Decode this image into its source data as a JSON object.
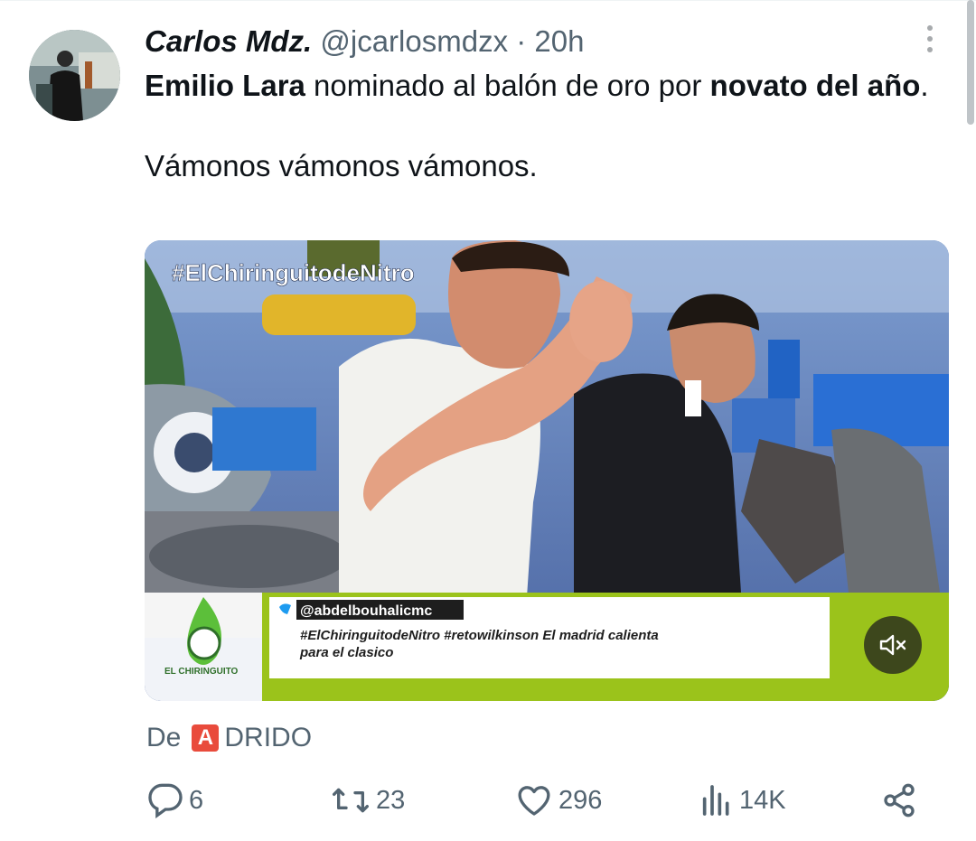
{
  "tweet": {
    "display_name": "Carlos Mdz.",
    "handle": "@jcarlosmdzx",
    "separator": "·",
    "time": "20h",
    "text_line1_bold_a": "Emilio Lara",
    "text_line1_plain": " nominado al balón de oro por ",
    "text_line1_bold_b": "novato del año",
    "text_line1_end": ".",
    "text_line2": "Vámonos vámonos vámonos.",
    "source_prefix": "De",
    "source_badge": "A",
    "source_name": "DRIDO"
  },
  "video": {
    "overlay_hashtag": "#ElChiringuitodeNitro",
    "ticker_user": "@abdelbouhalicmc",
    "ticker_line1": "#ElChiringuitodeNitro #retowilkinson El madrid calienta",
    "ticker_line2": "para el clasico",
    "logo_caption": "EL CHIRINGUITO",
    "muted_icon": "speaker-muted-icon"
  },
  "actions": {
    "reply_count": "6",
    "retweet_count": "23",
    "like_count": "296",
    "views_count": "14K"
  },
  "colors": {
    "text": "#0f1419",
    "secondary": "#536471",
    "badge_red": "#e94b3c",
    "ticker_green": "#9bc31b"
  }
}
